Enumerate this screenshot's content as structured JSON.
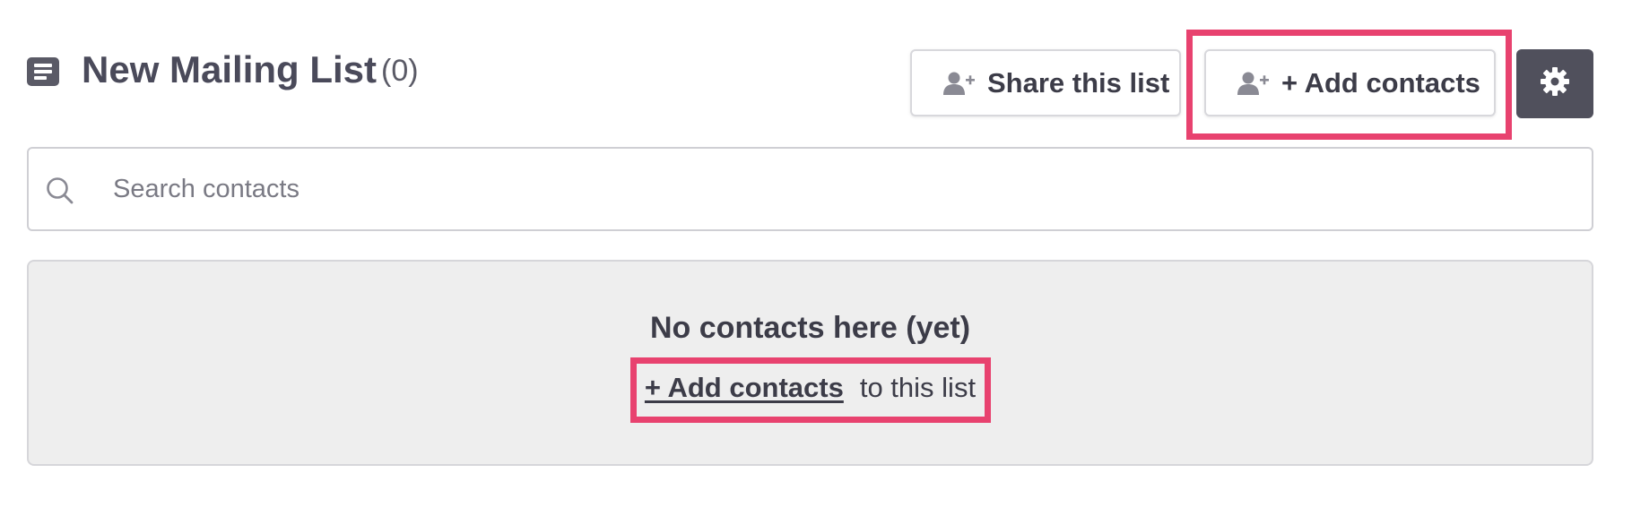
{
  "header": {
    "title": "New Mailing List",
    "count": "(0)"
  },
  "toolbar": {
    "share_label": "Share this list",
    "add_label": "+ Add contacts",
    "settings_icon": "gear-icon"
  },
  "search": {
    "placeholder": "Search contacts",
    "value": ""
  },
  "empty_state": {
    "title": "No contacts here (yet)",
    "link_label": "+ Add contacts",
    "suffix": "to this list"
  },
  "colors": {
    "highlight": "#e8426f",
    "settings_button": "#50505c",
    "empty_background": "#eeeeee",
    "text": "#3c3c48"
  }
}
